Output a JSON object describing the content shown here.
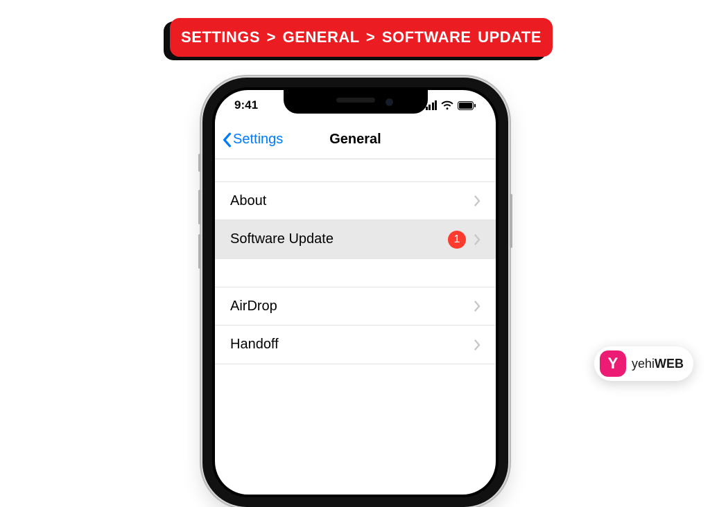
{
  "breadcrumb": {
    "text": "SETTINGS  >  GENERAL  >  SOFTWARE UPDATE"
  },
  "status_bar": {
    "time": "9:41"
  },
  "navbar": {
    "back_label": "Settings",
    "title": "General"
  },
  "list": {
    "items": [
      {
        "label": "About",
        "badge": null,
        "highlight": false,
        "first_of_group": true
      },
      {
        "label": "Software Update",
        "badge": "1",
        "highlight": true,
        "first_of_group": false
      }
    ],
    "second_group": [
      {
        "label": "AirDrop",
        "first_of_group": true
      },
      {
        "label": "Handoff",
        "first_of_group": false
      }
    ]
  },
  "watermark": {
    "mark": "Y",
    "text_prefix": "yehi",
    "text_bold": "WEB"
  }
}
